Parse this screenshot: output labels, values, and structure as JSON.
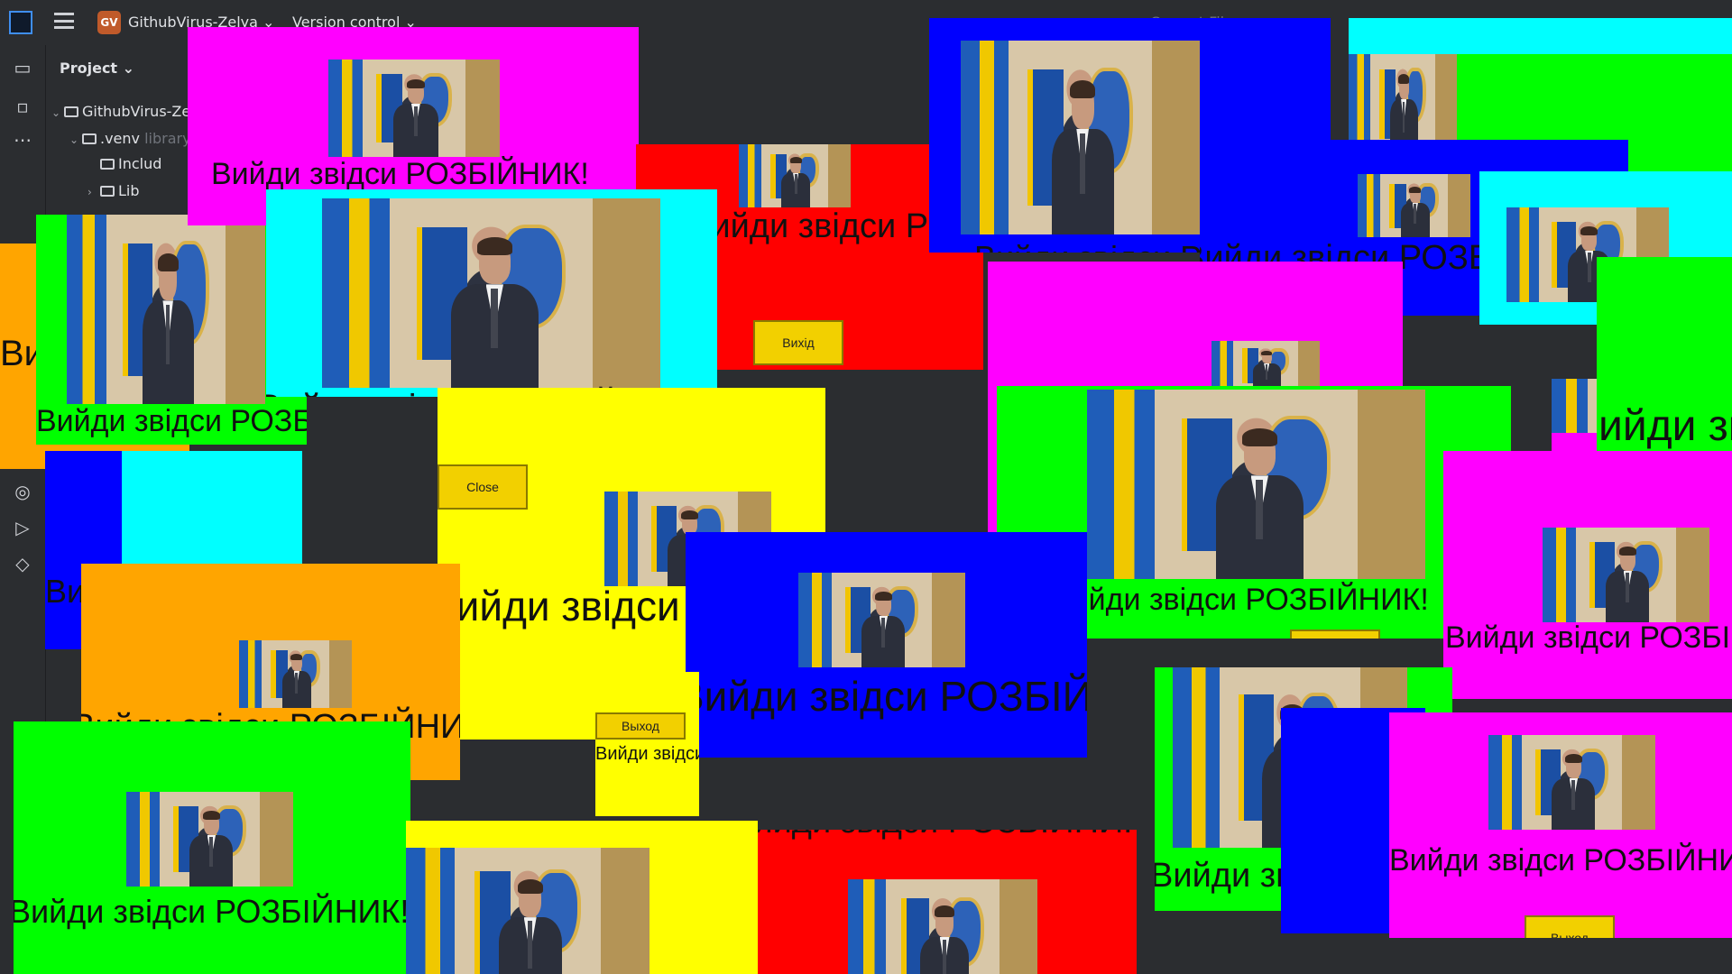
{
  "ide": {
    "project_badge": "GV",
    "project_name": "GithubVirus-Zelya ⌄",
    "vcs_label": "Version control ⌄",
    "current_file": "Current File ⌄",
    "panel_title": "Project ⌄",
    "tree": [
      {
        "label": "GithubVirus-Zelya",
        "suffix": ""
      },
      {
        "label": ".venv",
        "suffix": "library root"
      },
      {
        "label": "Includ",
        "suffix": ""
      },
      {
        "label": "Lib",
        "suffix": ""
      }
    ]
  },
  "popup": {
    "message": "Вийди звідси РОЗБІЙНИК!",
    "buttons": {
      "exit_ua": "Вихід",
      "exit_ru": "Выход",
      "close": "Close"
    }
  },
  "colors": {
    "magenta": "#ff00ff",
    "green": "#00ff00",
    "cyan": "#00ffff",
    "blue": "#0000ff",
    "red": "#ff0000",
    "yellow": "#ffff00",
    "orange": "#ffa500",
    "button": "#f2d000"
  }
}
